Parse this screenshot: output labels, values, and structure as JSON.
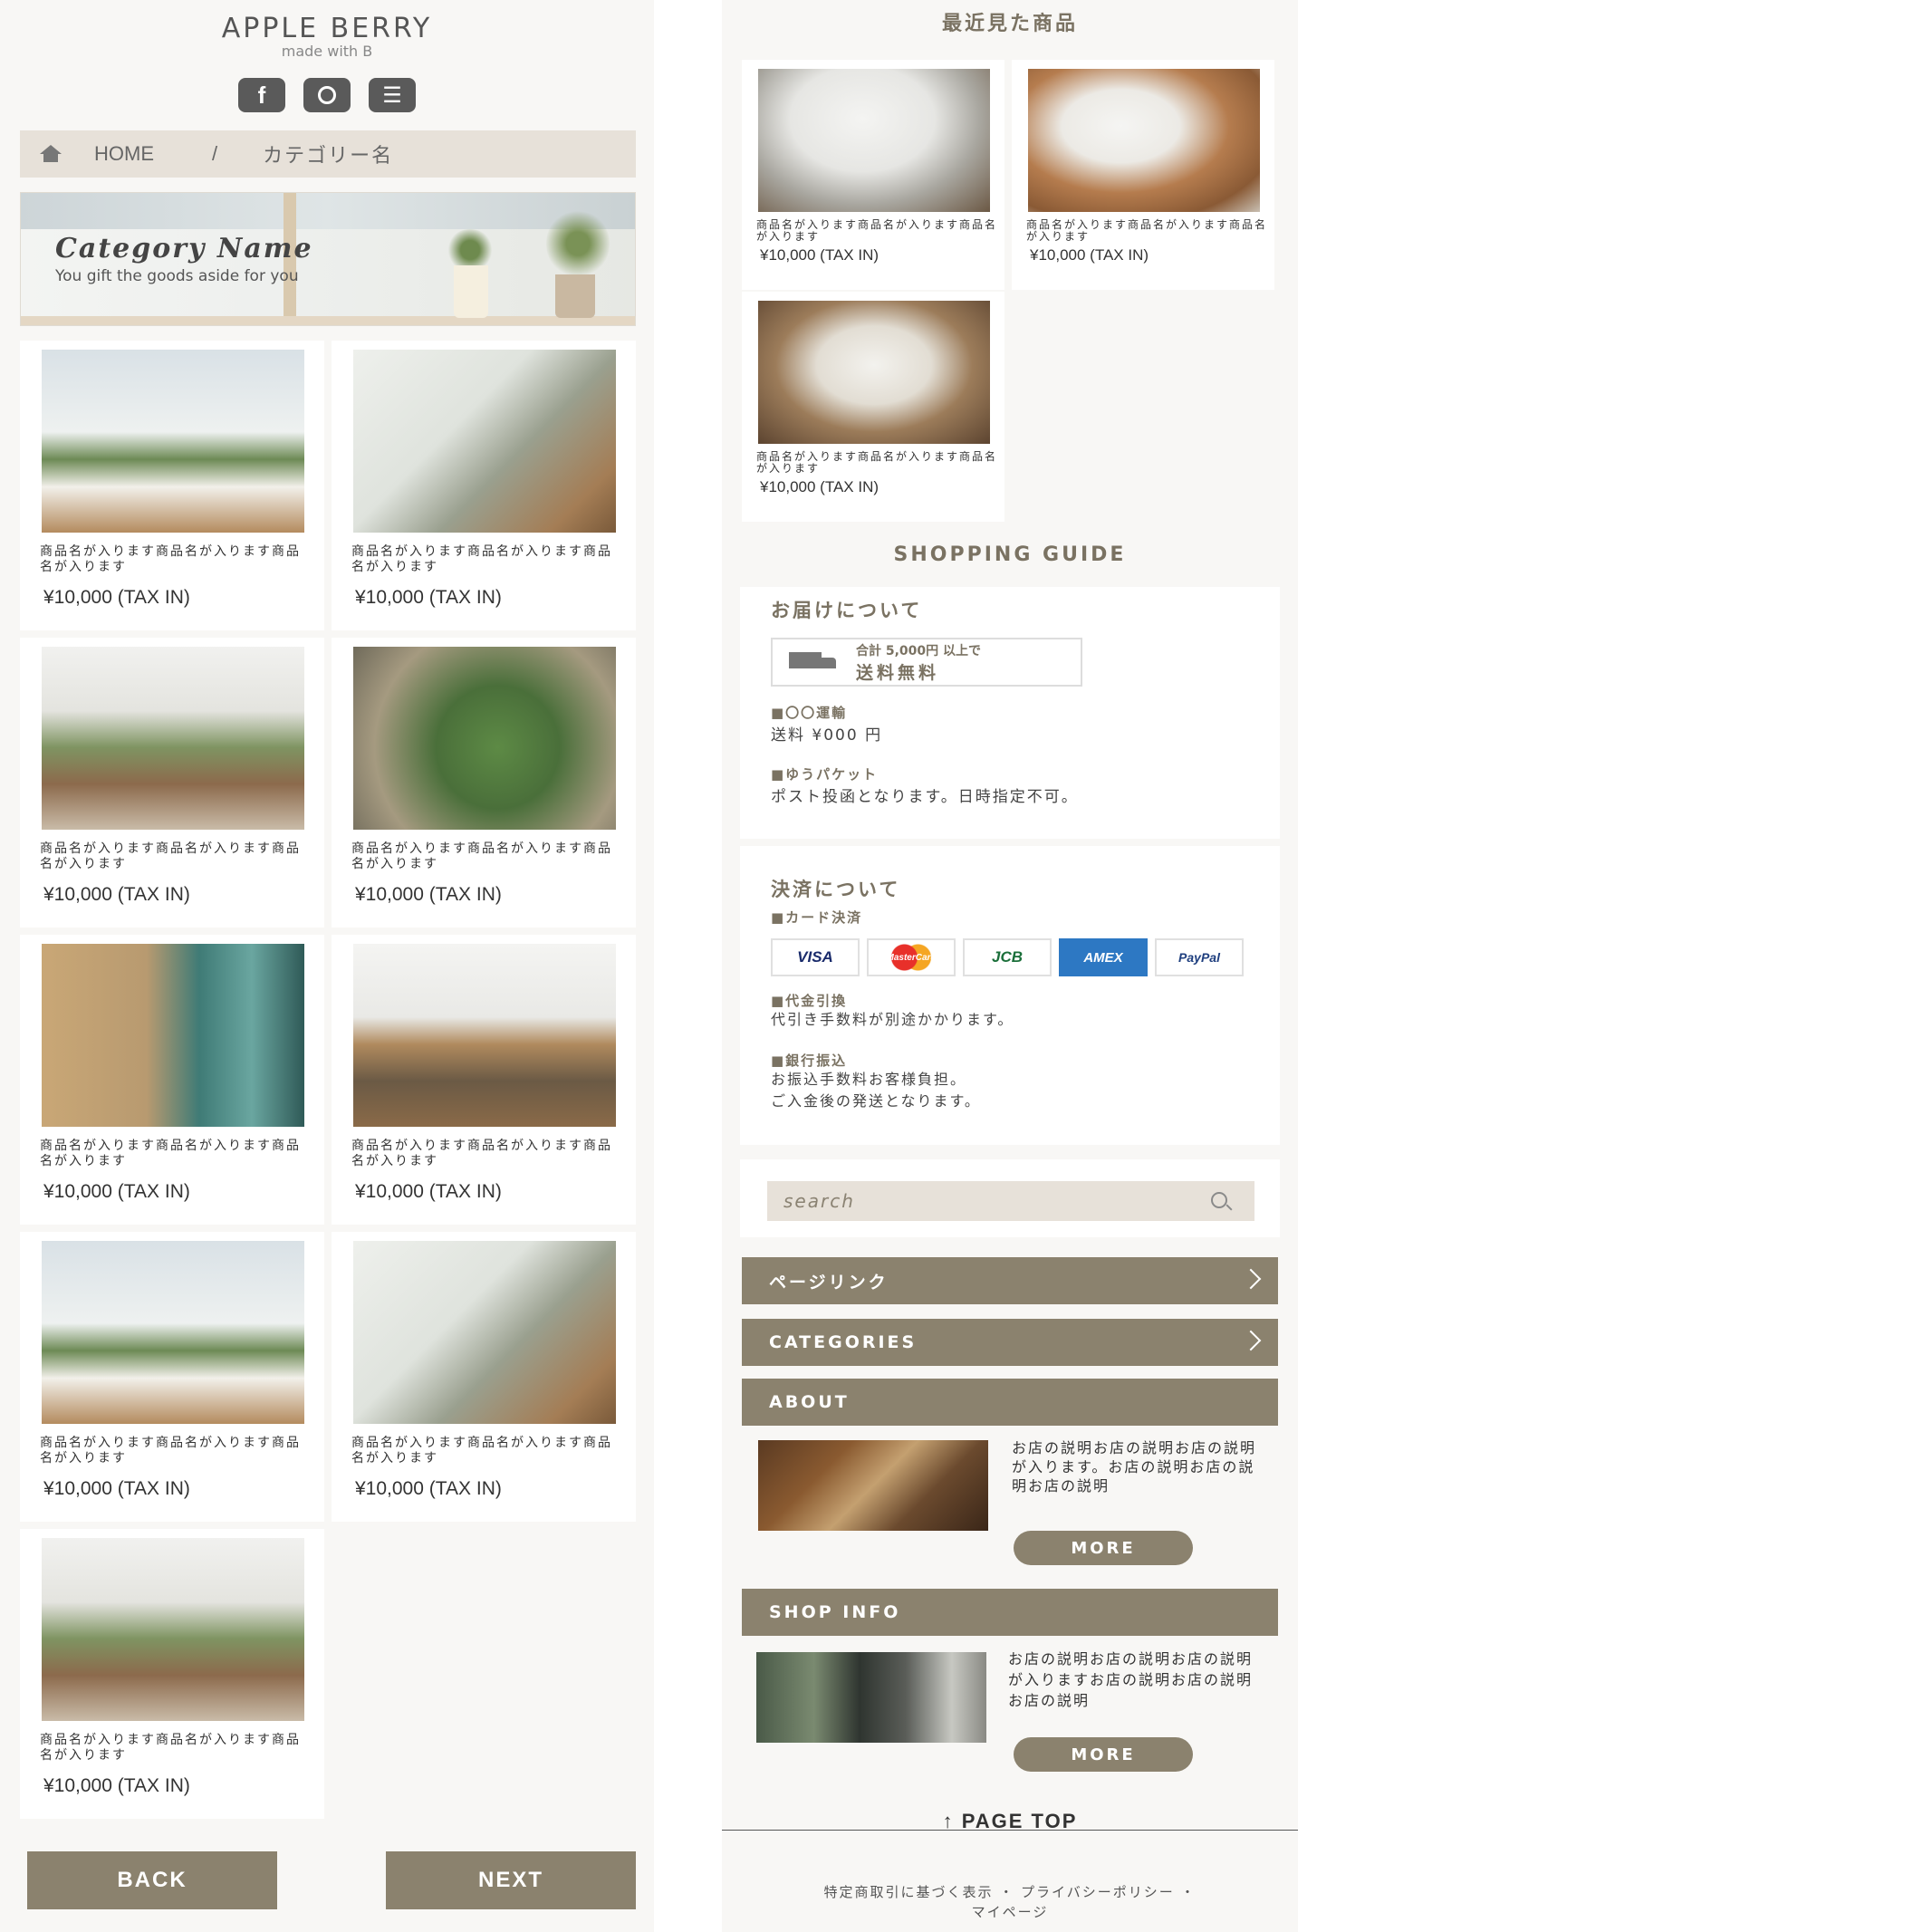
{
  "header": {
    "logo": "APPLE BERRY",
    "tagline": "made with B",
    "icons": [
      "facebook-icon",
      "instagram-icon",
      "menu-icon"
    ]
  },
  "breadcrumb": {
    "home": "HOME",
    "sep": "/",
    "current": "カテゴリー名"
  },
  "banner": {
    "title": "Category Name",
    "subtitle": "You gift the goods aside for you"
  },
  "product_name": "商品名が入ります商品名が入ります商品名が入ります",
  "product_price": "¥10,000 (TAX IN)",
  "products": [
    {
      "name": "商品名が入ります商品名が入ります商品名が入ります",
      "price": "¥10,000 (TAX IN)"
    },
    {
      "name": "商品名が入ります商品名が入ります商品名が入ります",
      "price": "¥10,000 (TAX IN)"
    },
    {
      "name": "商品名が入ります商品名が入ります商品名が入ります",
      "price": "¥10,000 (TAX IN)"
    },
    {
      "name": "商品名が入ります商品名が入ります商品名が入ります",
      "price": "¥10,000 (TAX IN)"
    },
    {
      "name": "商品名が入ります商品名が入ります商品名が入ります",
      "price": "¥10,000 (TAX IN)"
    },
    {
      "name": "商品名が入ります商品名が入ります商品名が入ります",
      "price": "¥10,000 (TAX IN)"
    },
    {
      "name": "商品名が入ります商品名が入ります商品名が入ります",
      "price": "¥10,000 (TAX IN)"
    },
    {
      "name": "商品名が入ります商品名が入ります商品名が入ります",
      "price": "¥10,000 (TAX IN)"
    },
    {
      "name": "商品名が入ります商品名が入ります商品名が入ります",
      "price": "¥10,000 (TAX IN)"
    }
  ],
  "pager": {
    "back": "BACK",
    "next": "NEXT"
  },
  "recent": {
    "title": "最近見た商品",
    "items": [
      {
        "name": "商品名が入ります商品名が入ります商品名が入ります",
        "price": "¥10,000 (TAX IN)"
      },
      {
        "name": "商品名が入ります商品名が入ります商品名が入ります",
        "price": "¥10,000 (TAX IN)"
      },
      {
        "name": "商品名が入ります商品名が入ります商品名が入ります",
        "price": "¥10,000 (TAX IN)"
      }
    ]
  },
  "guide": {
    "title": "SHOPPING GUIDE",
    "delivery": {
      "heading": "お届けについて",
      "free_line1": "合計 5,000円 以上で",
      "free_line2": "送料無料",
      "carrier1_label": "■〇〇運輸",
      "carrier1_text": "送料 ¥000 円",
      "carrier2_label": "■ゆうパケット",
      "carrier2_text": "ポスト投函となります。日時指定不可。"
    },
    "payment": {
      "heading": "決済について",
      "card_label": "■カード決済",
      "cards": [
        "VISA",
        "MasterCard",
        "JCB",
        "AMEX",
        "PayPal"
      ],
      "cod_label": "■代金引換",
      "cod_text": "代引き手数料が別途かかります。",
      "bank_label": "■銀行振込",
      "bank_text1": "お振込手数料お客様負担。",
      "bank_text2": "ご入金後の発送となります。"
    }
  },
  "search": {
    "placeholder": "search"
  },
  "nav": {
    "page_link": "ページリンク",
    "categories": "CATEGORIES",
    "about": "ABOUT",
    "shop_info": "SHOP INFO"
  },
  "about": {
    "text": "お店の説明お店の説明お店の説明が入ります。お店の説明お店の説明お店の説明",
    "more": "MORE"
  },
  "shop_info": {
    "text": "お店の説明お店の説明お店の説明が入りますお店の説明お店の説明お店の説明",
    "more": "MORE"
  },
  "page_top": "↑ PAGE TOP",
  "footer": {
    "line1": "特定商取引に基づく表示 ・ プライバシーポリシー ・",
    "line2": "マイページ"
  },
  "colors": {
    "accent": "#8b826e",
    "breadcrumb_bg": "#e7e1d9",
    "page_bg": "#f8f7f5"
  }
}
